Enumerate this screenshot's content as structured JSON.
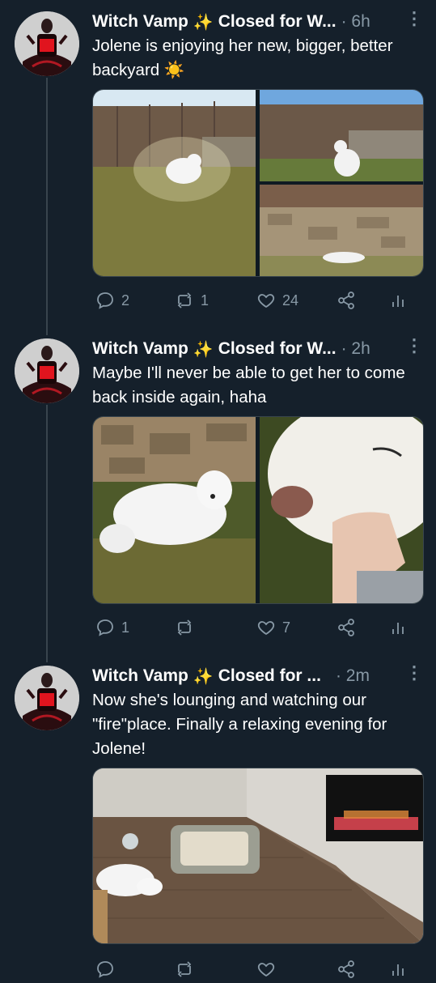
{
  "tweets": [
    {
      "name": "Witch Vamp",
      "name_suffix": "Closed for W...",
      "time": "· 6h",
      "text": "Jolene is enjoying her new, bigger, better backyard ☀️",
      "media": [
        "dog-in-backyard-sunlight",
        "dog-sitting-on-lawn",
        "dog-lying-by-stone-wall"
      ],
      "replies": "2",
      "retweets": "1",
      "likes": "24"
    },
    {
      "name": "Witch Vamp",
      "name_suffix": "Closed for W...",
      "time": "· 2h",
      "text": "Maybe I'll never be able to get her to come back inside again, haha",
      "media": [
        "dog-lying-on-grass",
        "dog-face-closeup-with-hand"
      ],
      "replies": "1",
      "retweets": "",
      "likes": "7"
    },
    {
      "name": "Witch Vamp",
      "name_suffix": "Closed for ...",
      "time": "· 2m",
      "text": "Now she's lounging and watching our \"fire\"place. Finally a relaxing evening for Jolene!",
      "media": [
        "dog-lying-by-electric-fireplace"
      ],
      "replies": "",
      "retweets": "",
      "likes": ""
    }
  ],
  "colors": {
    "background": "#15202b",
    "muted": "#8899a6",
    "line": "#38444d"
  }
}
